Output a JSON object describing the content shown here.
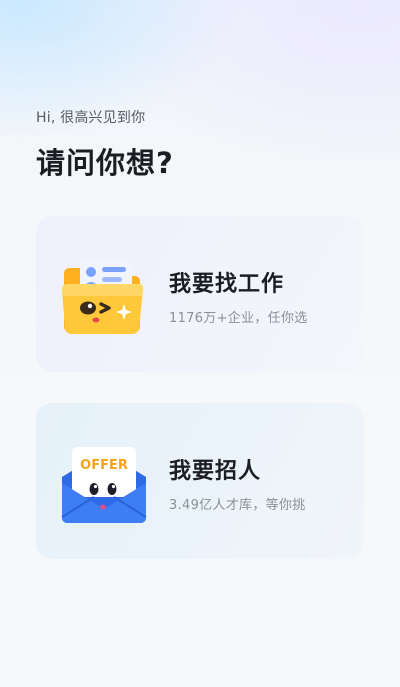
{
  "header": {
    "greeting": "Hi, 很高兴见到你",
    "title": "请问你想?"
  },
  "cards": [
    {
      "title": "我要找工作",
      "subtitle": "1176万+企业，任你选",
      "icon": "folder-mascot-icon"
    },
    {
      "title": "我要招人",
      "subtitle": "3.49亿人才库，等你挑",
      "icon": "offer-envelope-icon",
      "icon_text": "OFFER"
    }
  ],
  "colors": {
    "folder_yellow": "#ffc83a",
    "envelope_blue": "#3d7ef5",
    "offer_orange": "#f7a21b",
    "title_text": "#1b1d22",
    "subtitle_text": "#8a8f9c"
  }
}
